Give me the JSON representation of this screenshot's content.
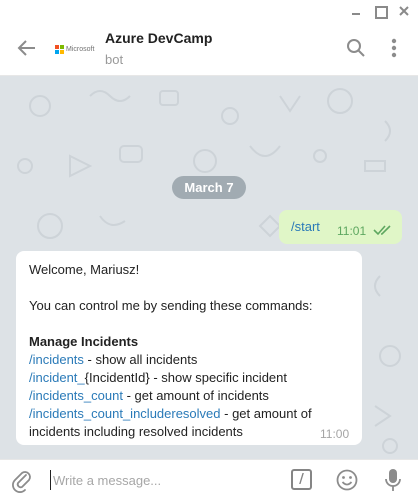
{
  "header": {
    "title": "Azure DevCamp",
    "subtitle": "bot",
    "avatar_text": "Microsoft"
  },
  "chat": {
    "date": "March 7",
    "outgoing": {
      "text": "/start",
      "time": "11:01"
    },
    "incoming": {
      "greeting": "Welcome, Mariusz!",
      "intro": "You can control me by sending these commands:",
      "section": "Manage Incidents",
      "commands": [
        {
          "cmd": "/incidents",
          "desc": " - show all incidents"
        },
        {
          "cmd": "/incident_",
          "desc": "{IncidentId} - show specific incident"
        },
        {
          "cmd": "/incidents_count",
          "desc": " - get amount of incidents"
        },
        {
          "cmd": "/incidents_count_includeresolved",
          "desc": " - get amount of"
        }
      ],
      "wrap_line": "incidents including resolved incidents",
      "time": "11:00"
    }
  },
  "composer": {
    "placeholder": "Write a message...",
    "command_glyph": "/"
  },
  "colors": {
    "link": "#2a7ab8",
    "outgoing_bubble": "#e0f6c7",
    "chat_background": "#dde2e6",
    "date_pill": "#a1abb2",
    "ms_red": "#f25022",
    "ms_green": "#7fba00",
    "ms_blue": "#00a4ef",
    "ms_yellow": "#ffb900"
  },
  "icons": {
    "back": "arrow-left-icon",
    "search": "search-icon",
    "more": "more-vertical-icon",
    "attach": "paperclip-icon",
    "emoji": "smile-icon",
    "mic": "microphone-icon",
    "read": "double-check-icon"
  }
}
